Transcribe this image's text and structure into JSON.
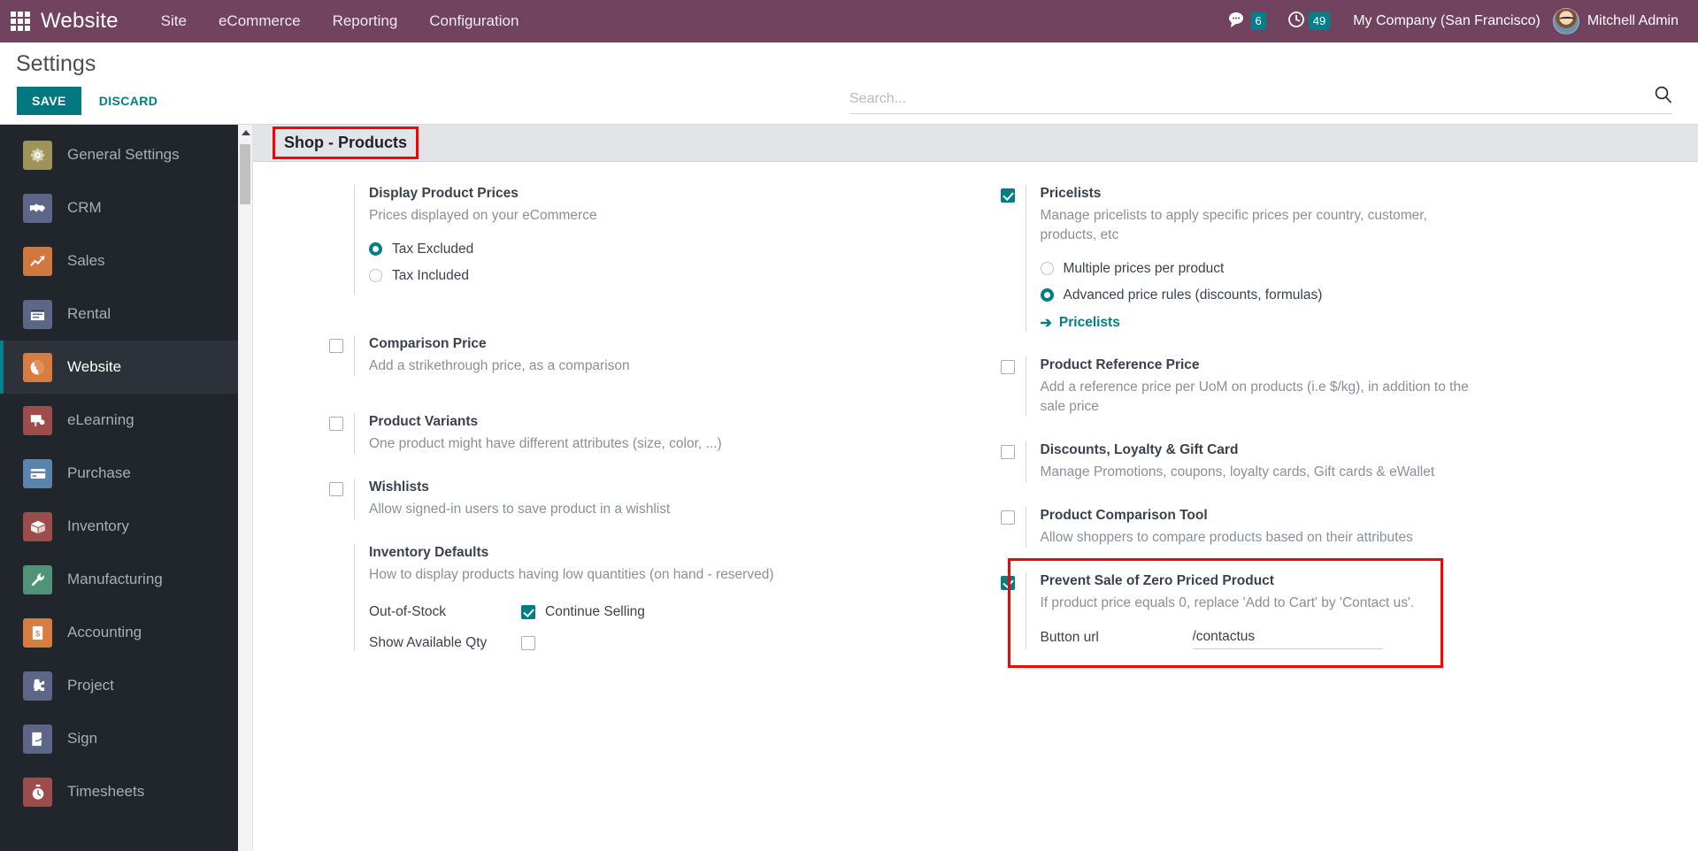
{
  "navbar": {
    "apps_icon": "apps-grid-icon",
    "brand": "Website",
    "menu": [
      "Site",
      "eCommerce",
      "Reporting",
      "Configuration"
    ],
    "messages_badge": "6",
    "activities_badge": "49",
    "company": "My Company (San Francisco)",
    "user": "Mitchell Admin",
    "bg_color": "#71435f",
    "badge_color": "#00808a"
  },
  "control_panel": {
    "title": "Settings",
    "save_label": "SAVE",
    "discard_label": "DISCARD",
    "save_color": "#00787f",
    "search_placeholder": "Search...",
    "search_value": ""
  },
  "sidebar": {
    "items": [
      {
        "label": "General Settings",
        "icon": "gear-icon",
        "color": "#9f9457",
        "active": false
      },
      {
        "label": "CRM",
        "icon": "handshake-icon",
        "color": "#5d6689",
        "active": false
      },
      {
        "label": "Sales",
        "icon": "chart-up-icon",
        "color": "#d2783f",
        "active": false
      },
      {
        "label": "Rental",
        "icon": "calendar-icon",
        "color": "#5c6787",
        "active": false
      },
      {
        "label": "Website",
        "icon": "globe-icon",
        "color": "#d97c40",
        "active": true
      },
      {
        "label": "eLearning",
        "icon": "presentation-icon",
        "color": "#9d4c4c",
        "active": false
      },
      {
        "label": "Purchase",
        "icon": "card-icon",
        "color": "#5a84ac",
        "active": false
      },
      {
        "label": "Inventory",
        "icon": "box-icon",
        "color": "#9d4c4c",
        "active": false
      },
      {
        "label": "Manufacturing",
        "icon": "wrench-icon",
        "color": "#4f9478",
        "active": false
      },
      {
        "label": "Accounting",
        "icon": "invoice-icon",
        "color": "#d97c40",
        "active": false
      },
      {
        "label": "Project",
        "icon": "puzzle-icon",
        "color": "#5d6689",
        "active": false
      },
      {
        "label": "Sign",
        "icon": "signature-icon",
        "color": "#5d6689",
        "active": false
      },
      {
        "label": "Timesheets",
        "icon": "stopwatch-icon",
        "color": "#9d4c4c",
        "active": false
      }
    ]
  },
  "settings": {
    "section_title": "Shop - Products",
    "section_highlighted": true,
    "left_column": [
      {
        "name": "Display Product Prices",
        "desc": "Prices displayed on your eCommerce",
        "has_checkbox": false,
        "radios": [
          {
            "label": "Tax Excluded",
            "selected": true
          },
          {
            "label": "Tax Included",
            "selected": false
          }
        ]
      },
      {
        "name": "Comparison Price",
        "desc": "Add a strikethrough price, as a comparison",
        "has_checkbox": true,
        "checked": false
      },
      {
        "name": "Product Variants",
        "desc": "One product might have different attributes (size, color, ...)",
        "has_checkbox": true,
        "checked": false
      },
      {
        "name": "Wishlists",
        "desc": "Allow signed-in users to save product in a wishlist",
        "has_checkbox": true,
        "checked": false
      },
      {
        "name": "Inventory Defaults",
        "desc": "How to display products having low quantities (on hand - reserved)",
        "has_checkbox": false,
        "sub_fields": [
          {
            "label": "Out-of-Stock",
            "type": "checkbox",
            "checked": true,
            "suffix": "Continue Selling"
          },
          {
            "label": "Show Available Qty",
            "type": "checkbox",
            "checked": false,
            "suffix": ""
          }
        ]
      }
    ],
    "right_column": [
      {
        "name": "Pricelists",
        "desc": "Manage pricelists to apply specific prices per country, customer, products, etc",
        "has_checkbox": true,
        "checked": true,
        "radios": [
          {
            "label": "Multiple prices per product",
            "selected": false
          },
          {
            "label": "Advanced price rules (discounts, formulas)",
            "selected": true
          }
        ],
        "link": {
          "arrow": "arrow-right-icon",
          "label": "Pricelists"
        }
      },
      {
        "name": "Product Reference Price",
        "desc": "Add a reference price per UoM on products (i.e $/kg), in addition to the sale price",
        "has_checkbox": true,
        "checked": false
      },
      {
        "name": "Discounts, Loyalty & Gift Card",
        "desc": "Manage Promotions, coupons, loyalty cards, Gift cards & eWallet",
        "has_checkbox": true,
        "checked": false
      },
      {
        "name": "Product Comparison Tool",
        "desc": "Allow shoppers to compare products based on their attributes",
        "has_checkbox": true,
        "checked": false
      },
      {
        "name": "Prevent Sale of Zero Priced Product",
        "desc": "If product price equals 0, replace 'Add to Cart' by 'Contact us'.",
        "has_checkbox": true,
        "checked": true,
        "highlighted": true,
        "button_url_label": "Button url",
        "button_url_value": "/contactus"
      }
    ]
  },
  "colors": {
    "accent_teal": "#017e84",
    "annotation_red": "#ff0000",
    "sidebar_bg": "#21252c",
    "section_bg": "#e2e4e8"
  }
}
